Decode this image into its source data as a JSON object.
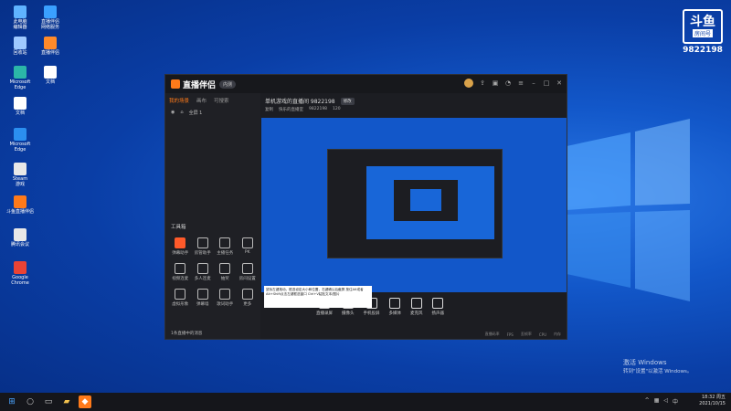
{
  "desktop": {
    "icons": [
      {
        "label": "此电脑\n编辑器",
        "color": "#5fb3ff"
      },
      {
        "label": "直播伴侣\n网络服务",
        "color": "#3aa0ff"
      },
      {
        "label": "回收站",
        "color": "#9ec9ff"
      },
      {
        "label": "直播伴侣",
        "color": "#ff8a2a"
      },
      {
        "label": "Microsoft\nEdge",
        "color": "#2bb6a8"
      },
      {
        "label": "文档",
        "color": "#ffffff"
      },
      {
        "label": "文档",
        "color": "#ffffff"
      },
      {
        "label": "Microsoft\nEdge",
        "color": "#2b8ff0"
      },
      {
        "label": "Steam\n游戏",
        "color": "#e8e8e8"
      },
      {
        "label": "斗鱼直播伴侣",
        "color": "#ff7a1a"
      },
      {
        "label": "腾讯会议",
        "color": "#e8e8e8"
      },
      {
        "label": "Google\nChrome",
        "color": "#ea4335"
      }
    ]
  },
  "watermark": {
    "logo": "斗鱼",
    "sub": "房间号",
    "room_id": "9822198"
  },
  "app": {
    "logo_text": "直播伴侣",
    "version_badge": "内测",
    "left_tabs": [
      "我的场景",
      "画布",
      "可搜索"
    ],
    "scene_label": "全屏 1",
    "room_title": "单机游戏的直播间 9822198",
    "room_tag": "修改",
    "sub_line": [
      "复制",
      "快乐的直播室",
      "9822198",
      "120"
    ],
    "toolbox_title": "工具箱",
    "tools": [
      {
        "label": "弹幕助手",
        "hot": true
      },
      {
        "label": "房管助手",
        "hot": false
      },
      {
        "label": "主播任务",
        "hot": false
      },
      {
        "label": "PK",
        "hot": false
      },
      {
        "label": "视频连麦",
        "hot": false
      },
      {
        "label": "多人连麦",
        "hot": false
      },
      {
        "label": "抽奖",
        "hot": false
      },
      {
        "label": "房间设置",
        "hot": false
      },
      {
        "label": "虚拟形象",
        "hot": false
      },
      {
        "label": "弹幕墙",
        "hot": false
      },
      {
        "label": "歌词助手",
        "hot": false
      },
      {
        "label": "更多",
        "hot": false
      }
    ],
    "left_footer": "1条直播中的消息",
    "bottom_buttons": [
      "直播录屏",
      "摄像头",
      "手机投屏",
      "多媒体",
      "麦克风",
      "扬声器"
    ],
    "status": [
      "直播码率",
      "FPS",
      "丢帧率",
      "CPU",
      "内存"
    ],
    "tooltip": "鼠标左键拖动，框选设定大小和位置，右键确认后截屏 按住Alt或者Alt+Shift点击左键框选窗口 Ctrl+V粘贴文本/图片"
  },
  "activation": {
    "title": "激活 Windows",
    "sub": "转到\"设置\"以激活 Windows。"
  },
  "taskbar": {
    "time": "18:32 周五",
    "date": "2021/10/15"
  }
}
